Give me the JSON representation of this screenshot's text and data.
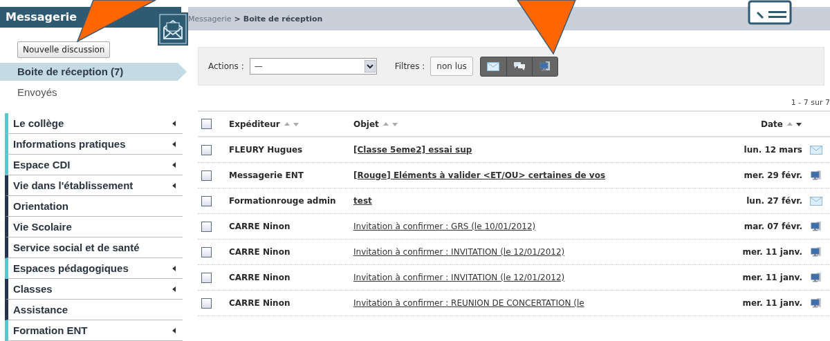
{
  "sidebar": {
    "title": "Messagerie",
    "new_button": "Nouvelle discussion",
    "folders": [
      {
        "label": "Boite de réception (7)",
        "selected": true
      },
      {
        "label": "Envoyés",
        "selected": false
      }
    ],
    "menu": [
      {
        "label": "Le collège",
        "color": "#5bc4cf",
        "submenu": true
      },
      {
        "label": "Informations pratiques",
        "color": "#5bc4cf",
        "submenu": true
      },
      {
        "label": "Espace CDI",
        "color": "#5bc4cf",
        "submenu": true
      },
      {
        "label": "Vie dans l'établissement",
        "color": "#283350",
        "submenu": true
      },
      {
        "label": "Orientation",
        "color": "#283350",
        "submenu": false
      },
      {
        "label": "Vie Scolaire",
        "color": "#283350",
        "submenu": false
      },
      {
        "label": "Service social et de santé",
        "color": "#283350",
        "submenu": false
      },
      {
        "label": "Espaces pédagogiques",
        "color": "#5bc4cf",
        "submenu": true
      },
      {
        "label": "Classes",
        "color": "#283350",
        "submenu": true
      },
      {
        "label": "Assistance",
        "color": "#283350",
        "submenu": false
      },
      {
        "label": "Formation ENT",
        "color": "#5bc4cf",
        "submenu": true
      }
    ]
  },
  "breadcrumb": {
    "parent": "Messagerie",
    "separator": ">",
    "current": "Boite de réception"
  },
  "toolbar": {
    "actions_label": "Actions :",
    "actions_value": "—",
    "filters_label": "Filtres :",
    "unread_button": "non lus",
    "filters": [
      {
        "kind": "mail",
        "selected": false
      },
      {
        "kind": "chat",
        "selected": false
      },
      {
        "kind": "notification",
        "selected": false
      }
    ]
  },
  "pagination": "1 - 7 sur 7",
  "table": {
    "select_all_checked": false,
    "columns": [
      "Expéditeur",
      "Objet",
      "Date"
    ],
    "rows": [
      {
        "sender": "FLEURY Hugues",
        "subject": "[Classe 5eme2] essai sup",
        "date": "lun. 12 mars",
        "kind": "mail",
        "checked": false
      },
      {
        "sender": "Messagerie ENT",
        "subject": "[Rouge] Eléments à valider <ET/OU> certaines de vos",
        "date": "mer. 29 févr.",
        "kind": "notification",
        "checked": false
      },
      {
        "sender": "Formationrouge admin",
        "subject": "test",
        "date": "lun. 27 févr.",
        "kind": "mail",
        "checked": false
      },
      {
        "sender": "CARRE Ninon",
        "subject": "Invitation à confirmer : GRS (le 10/01/2012)",
        "date": "mar. 07 févr.",
        "kind": "notification",
        "checked": false
      },
      {
        "sender": "CARRE Ninon",
        "subject": "Invitation à confirmer : INVITATION (le 12/01/2012)",
        "date": "mer. 11 janv.",
        "kind": "notification",
        "checked": false
      },
      {
        "sender": "CARRE Ninon",
        "subject": "Invitation à confirmer : INVITATION (le 12/01/2012)",
        "date": "mer. 11 janv.",
        "kind": "notification",
        "checked": false
      },
      {
        "sender": "CARRE Ninon",
        "subject": "Invitation à confirmer : REUNION DE CONCERTATION (le",
        "date": "mer. 11 janv.",
        "kind": "notification",
        "checked": false
      }
    ]
  }
}
